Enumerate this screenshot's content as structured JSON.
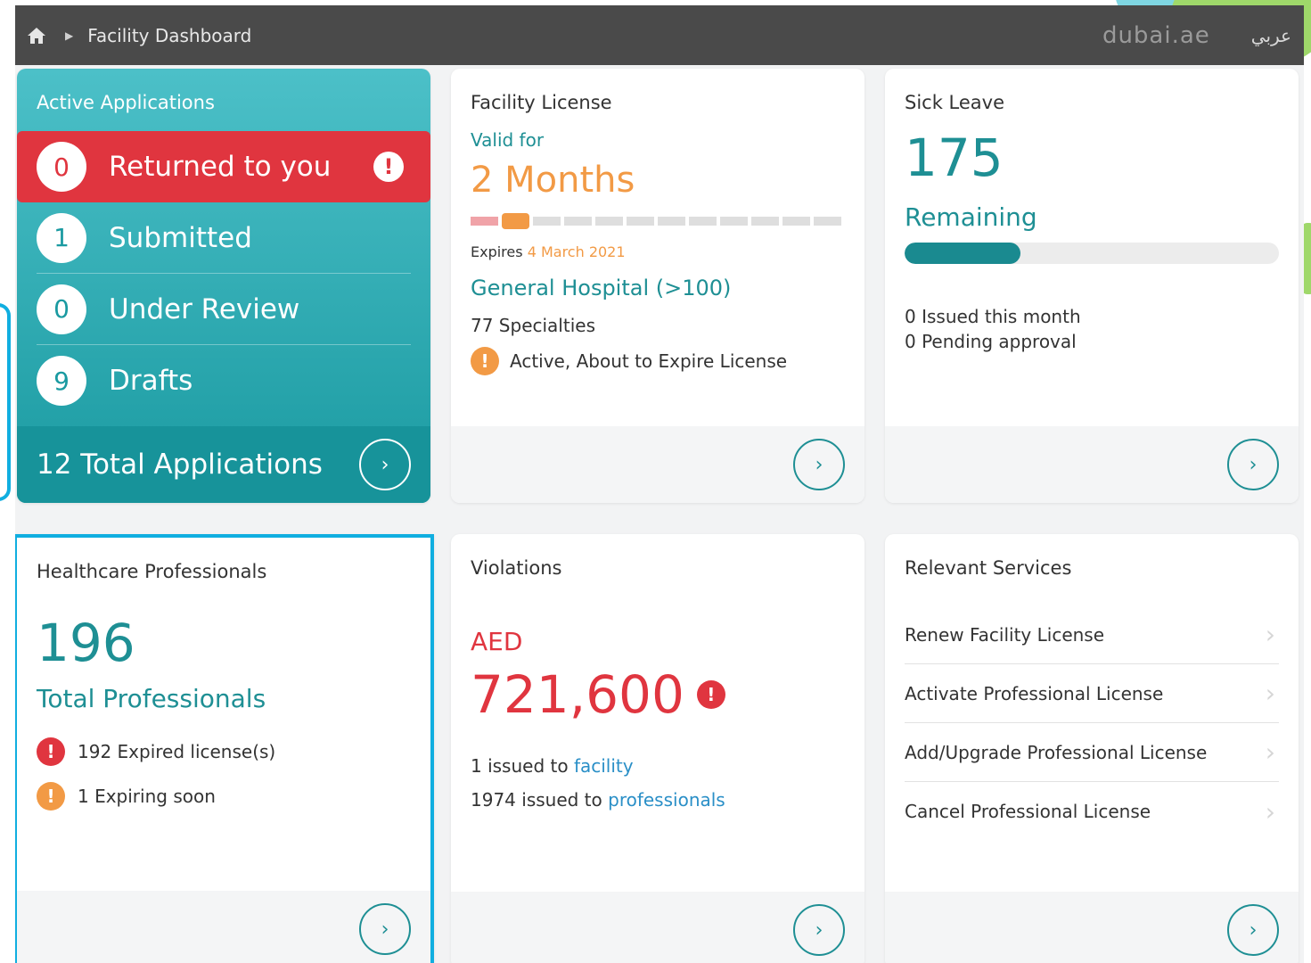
{
  "topbar": {
    "breadcrumb": "Facility Dashboard",
    "brand": "dubai.ae",
    "language": "عربي"
  },
  "active_applications": {
    "title": "Active Applications",
    "rows": [
      {
        "count": "0",
        "label": "Returned to you"
      },
      {
        "count": "1",
        "label": "Submitted"
      },
      {
        "count": "0",
        "label": "Under Review"
      },
      {
        "count": "9",
        "label": "Drafts"
      }
    ],
    "total_label": "12 Total Applications"
  },
  "facility_license": {
    "title": "Facility License",
    "valid_for_label": "Valid for",
    "duration": "2 Months",
    "expires_label": "Expires",
    "expires_date": "4 March 2021",
    "facility_type": "General Hospital (>100)",
    "specialties": "77 Specialties",
    "status": "Active, About to Expire License",
    "validity_segments_total": 12,
    "validity_segments_filled": 2
  },
  "sick_leave": {
    "title": "Sick Leave",
    "count": "175",
    "count_label": "Remaining",
    "remaining_fraction": 0.31,
    "issued": "0 Issued this month",
    "pending": "0 Pending approval"
  },
  "healthcare_professionals": {
    "title": "Healthcare Professionals",
    "count": "196",
    "count_label": "Total Professionals",
    "expired": "192 Expired license(s)",
    "expiring": "1 Expiring soon"
  },
  "violations": {
    "title": "Violations",
    "currency": "AED",
    "amount": "721,600",
    "facility_prefix": "1 issued to",
    "facility_link": "facility",
    "professionals_prefix": "1974 issued to",
    "professionals_link": "professionals"
  },
  "relevant_services": {
    "title": "Relevant Services",
    "items": [
      "Renew Facility License",
      "Activate Professional License",
      "Add/Upgrade Professional License",
      "Cancel Professional License"
    ]
  },
  "colors": {
    "teal": "#1e8f94",
    "red": "#e0353f",
    "orange": "#f29a45",
    "highlight": "#10aee0"
  },
  "icons": {
    "home": "home-icon",
    "arrow": "chevron-right-icon",
    "alert": "exclamation-icon"
  }
}
